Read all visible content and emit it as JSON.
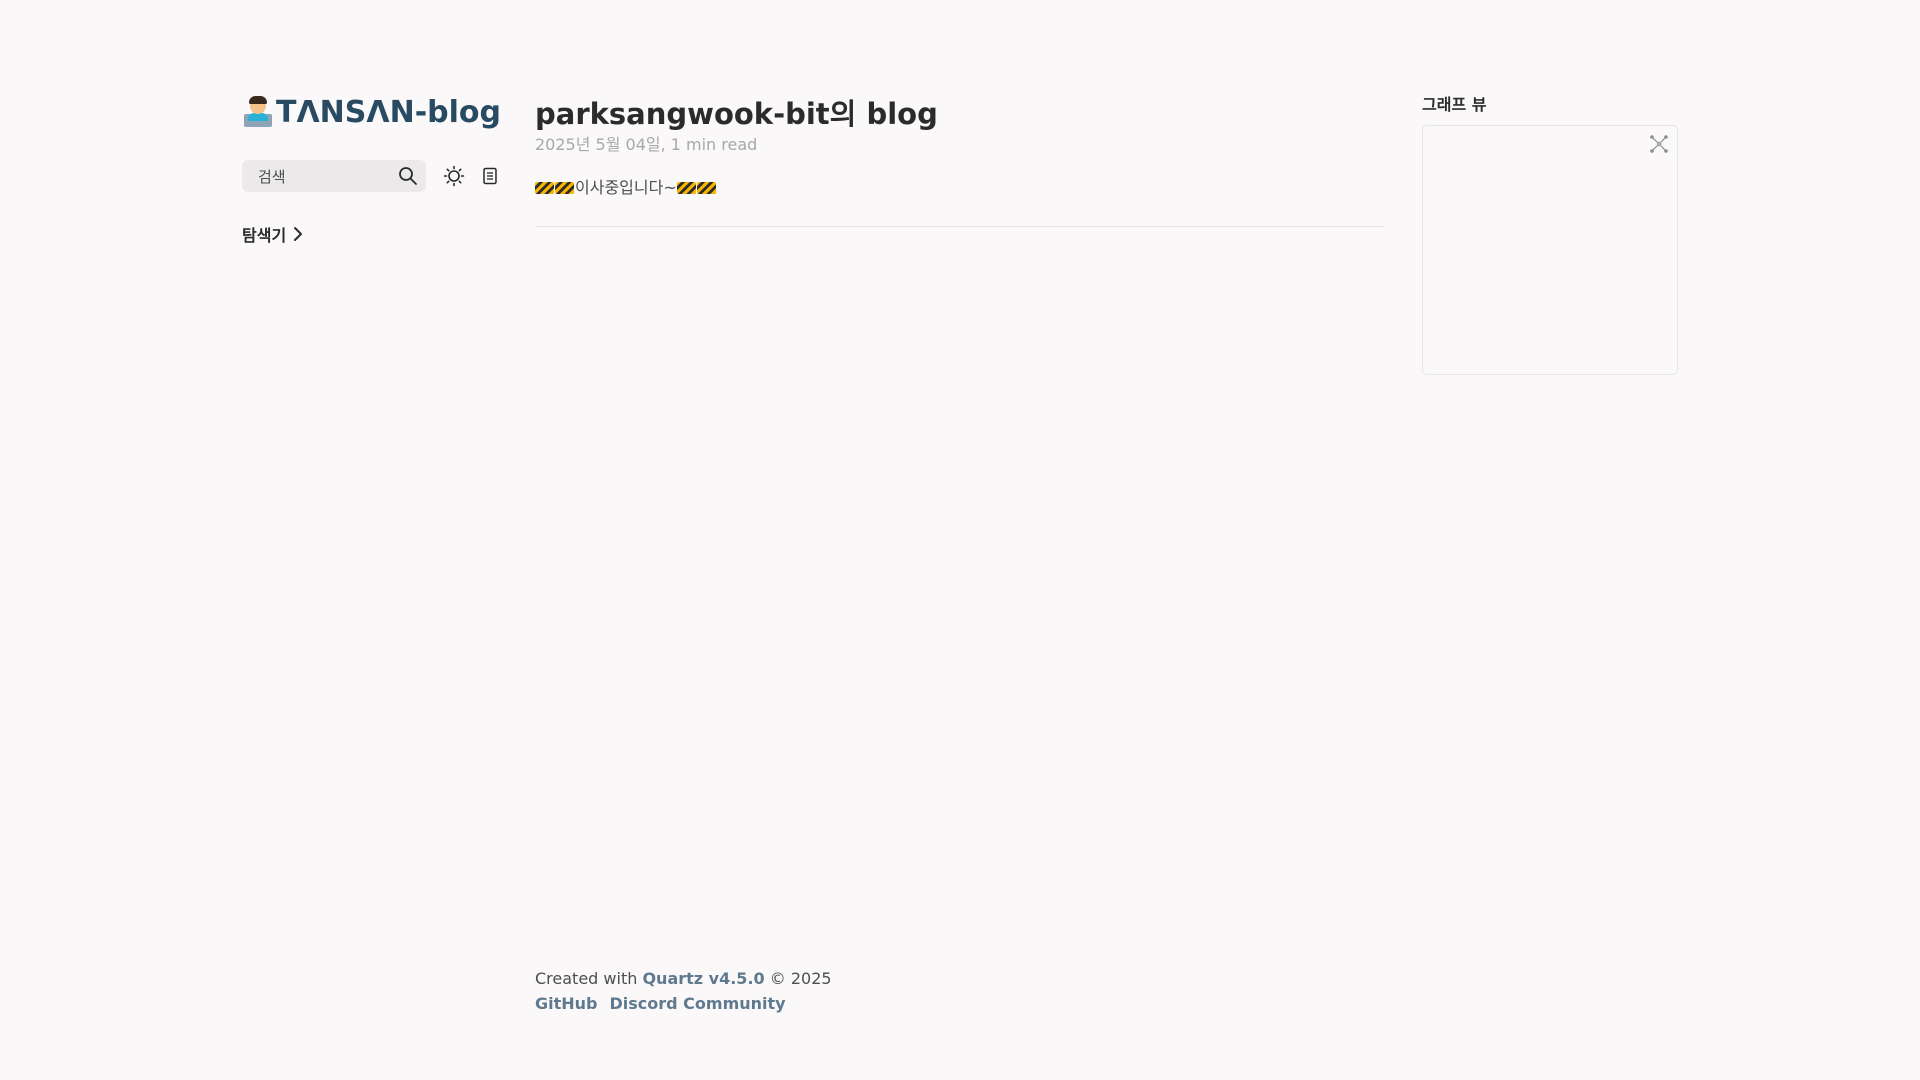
{
  "header": {
    "site_title": "TΛNSΛN-blog"
  },
  "sidebar": {
    "search_label": "검색",
    "explorer_label": "탐색기"
  },
  "article": {
    "title": "parksangwook-bit의 blog",
    "meta": "2025년 5월 04일, 1 min read",
    "content": "이사중입니다~"
  },
  "right": {
    "graph_title": "그래프 뷰"
  },
  "footer": {
    "created_prefix": "Created with",
    "quartz_link": "Quartz v4.5.0",
    "copyright": "© 2025",
    "links": [
      "GitHub",
      "Discord Community"
    ]
  },
  "icons": {
    "logo": "developer-emoji-icon",
    "search": "search-icon",
    "theme": "sun-icon",
    "reader": "document-icon",
    "explorer": "chevron-right-icon",
    "graph_expand": "expand-icon",
    "content_decoration": "construction-icon"
  },
  "colors": {
    "background": "#faf8f8",
    "title": "#284b63",
    "link": "#5f7a8f",
    "text": "#2b2b2b"
  }
}
